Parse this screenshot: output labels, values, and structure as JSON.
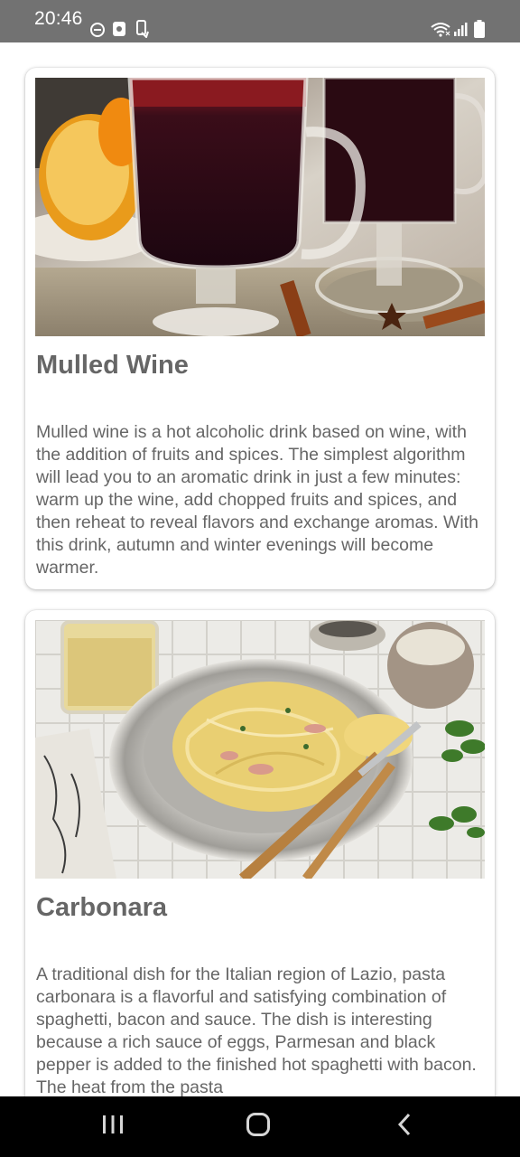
{
  "status_bar": {
    "time": "20:46",
    "icons_left": [
      "do-not-disturb-icon",
      "screenshot-icon",
      "phone-sync-icon"
    ],
    "icons_right": [
      "wifi-icon",
      "cellular-signal-icon",
      "battery-icon"
    ]
  },
  "recipes": [
    {
      "title": "Mulled Wine",
      "description": "Mulled wine is a hot alcoholic drink based on wine, with the addition of fruits and spices. The simplest algorithm will lead you to an aromatic drink in just a few minutes: warm up the wine, add chopped fruits and spices, and then reheat to reveal flavors and exchange aromas. With this drink, autumn and winter evenings will become warmer.",
      "image": "mulled-wine-photo"
    },
    {
      "title": "Carbonara",
      "description": "A traditional dish for the Italian region of Lazio, pasta carbonara is a flavorful and satisfying combination of spaghetti, bacon and sauce. The dish is interesting because a rich sauce of eggs, Parmesan and black pepper is added to the finished hot spaghetti with bacon. The heat from the pasta",
      "image": "carbonara-photo"
    }
  ],
  "nav_bar": {
    "buttons": [
      "recent-apps-icon",
      "home-icon",
      "back-icon"
    ]
  },
  "colors": {
    "status_bar_bg": "#727272",
    "text": "#666666",
    "nav_bar_bg": "#000000"
  }
}
